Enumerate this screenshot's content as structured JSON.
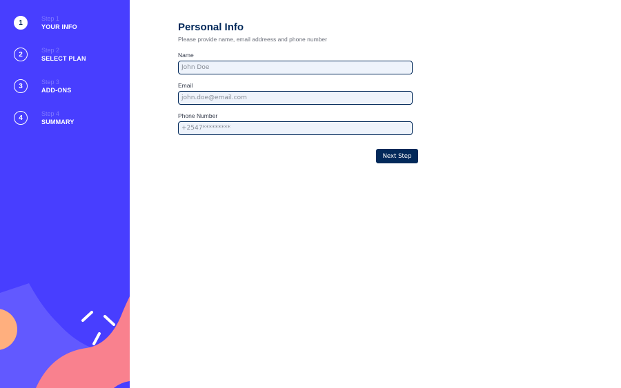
{
  "sidebar": {
    "steps": [
      {
        "number": "1",
        "caption": "Step 1",
        "title": "YOUR INFO",
        "active": true
      },
      {
        "number": "2",
        "caption": "Step 2",
        "title": "SELECT PLAN",
        "active": false
      },
      {
        "number": "3",
        "caption": "Step 3",
        "title": "ADD-ONS",
        "active": false
      },
      {
        "number": "4",
        "caption": "Step 4",
        "title": "SUMMARY",
        "active": false
      }
    ]
  },
  "form": {
    "title": "Personal Info",
    "subtitle": "Please provide name, email addreess and phone number",
    "name": {
      "label": "Name",
      "value": "",
      "placeholder": "John Doe"
    },
    "email": {
      "label": "Email",
      "value": "",
      "placeholder": "john.doe@email.com"
    },
    "phone": {
      "label": "Phone Number",
      "value": "",
      "placeholder": "+2547*********"
    },
    "next_label": "Next Step"
  },
  "colors": {
    "sidebar_bg": "#483eff",
    "primary_dark": "#02295a",
    "input_bg": "#eef3fb"
  }
}
